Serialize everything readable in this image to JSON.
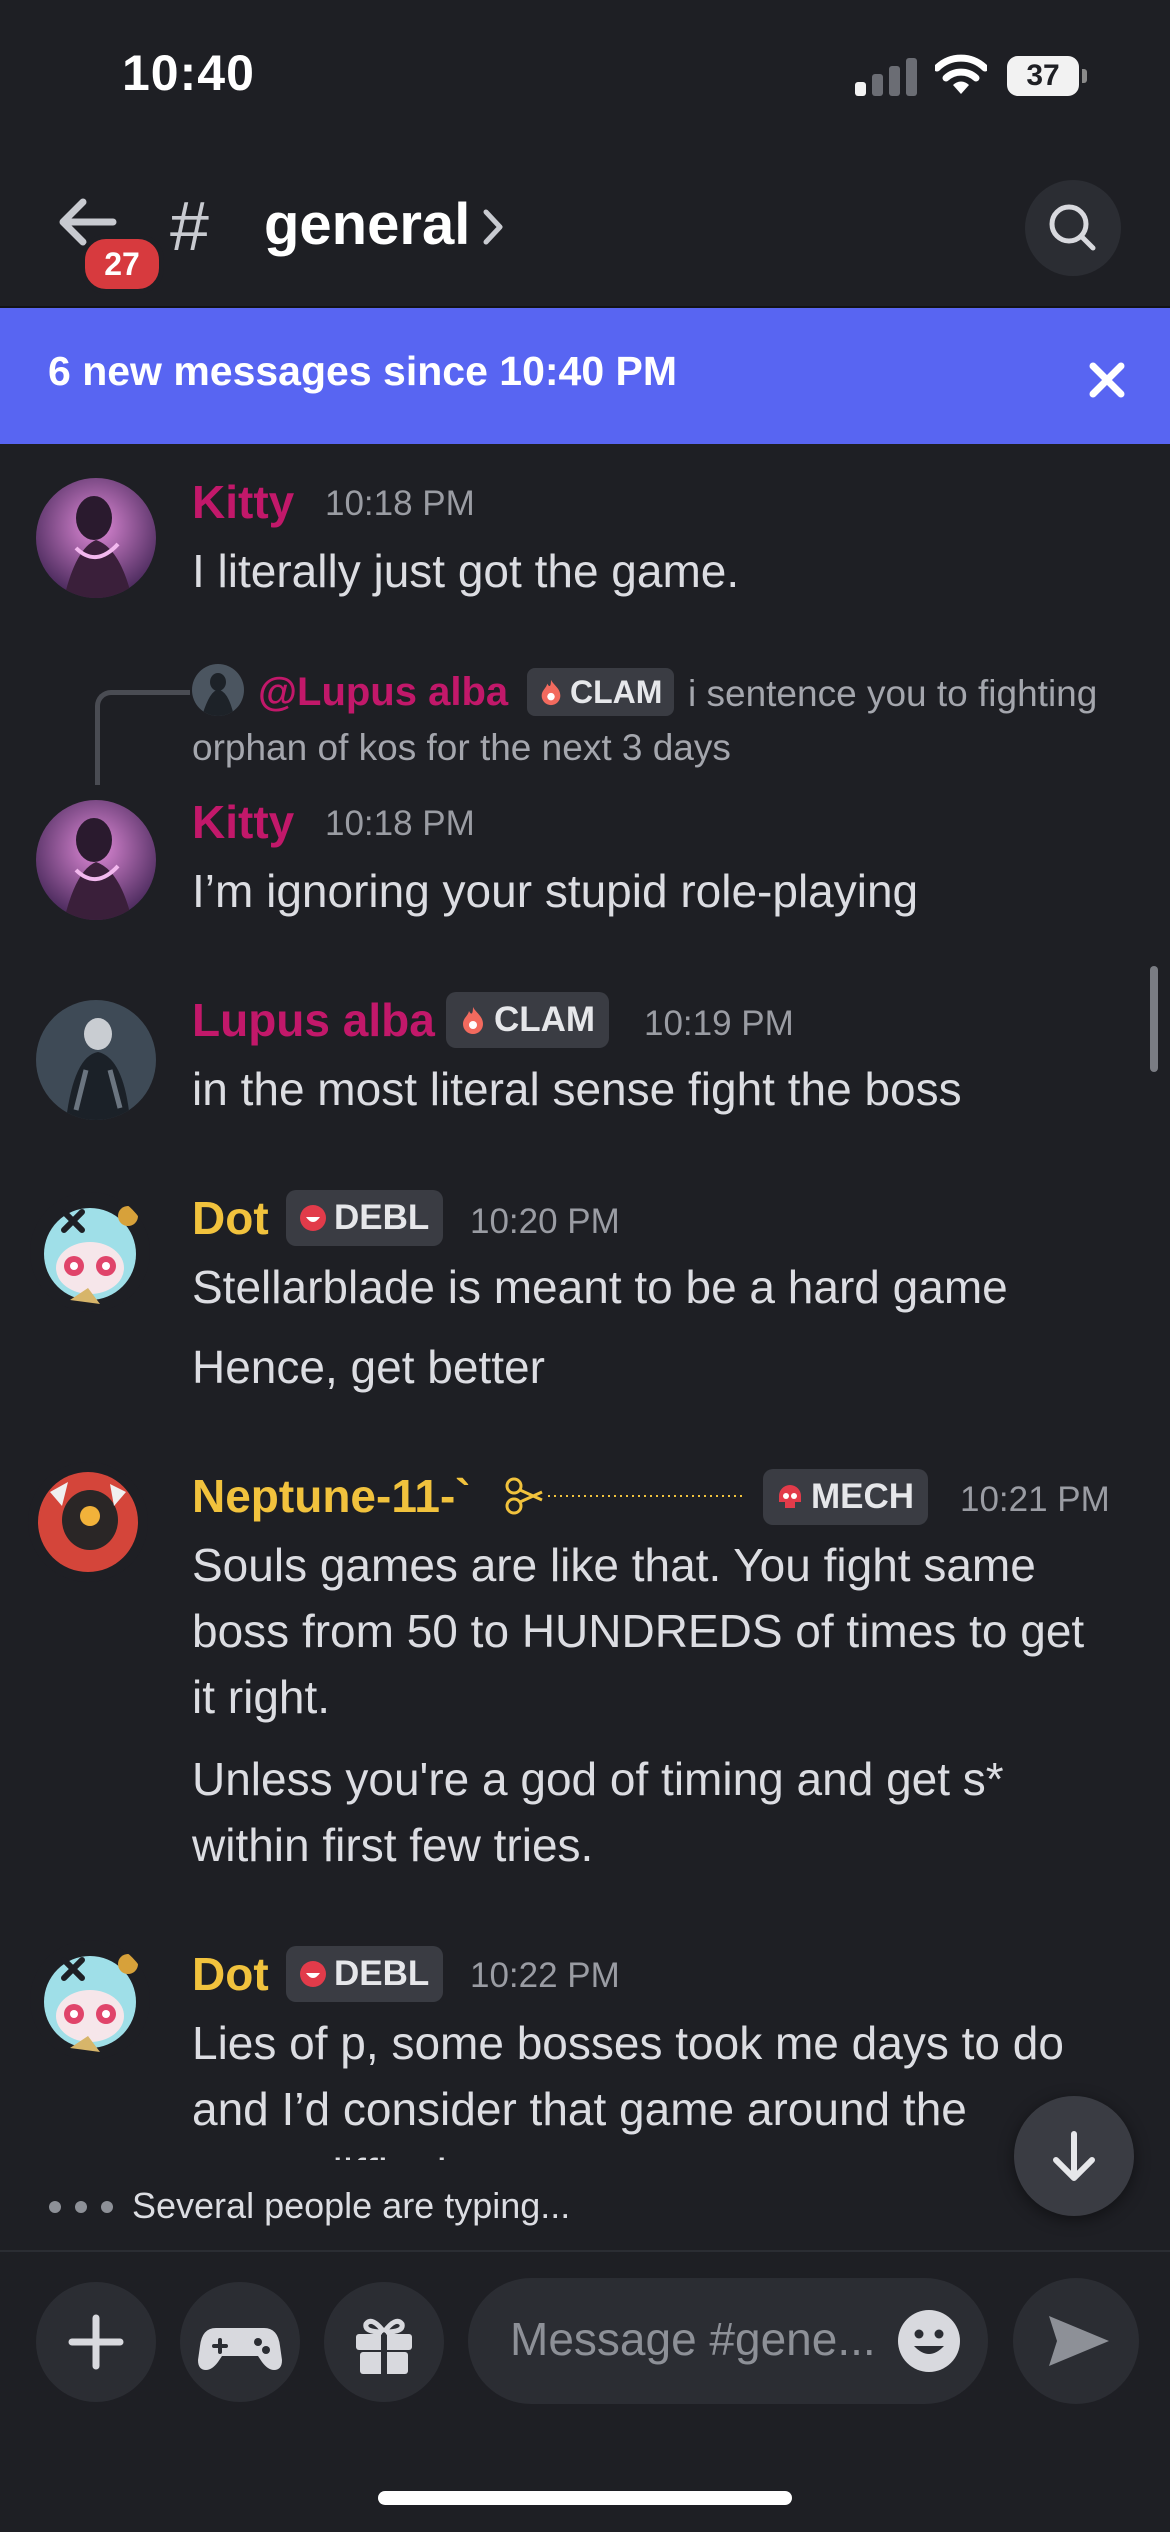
{
  "status_bar": {
    "time": "10:40",
    "battery": "37"
  },
  "header": {
    "badge_count": "27",
    "hash": "#",
    "channel": "general"
  },
  "banner": {
    "text": "6 new messages since 10:40 PM"
  },
  "reply": {
    "mention": "@Lupus alba",
    "tag": "CLAM",
    "text_line1": "i sentence you to fighting",
    "text_line2": "orphan of kos for the next 3 days"
  },
  "messages": [
    {
      "author": "Kitty",
      "time": "10:18 PM",
      "lines": [
        "I literally just got the game."
      ]
    },
    {
      "author": "Kitty",
      "time": "10:18 PM",
      "lines": [
        "I’m ignoring your stupid role-playing"
      ]
    },
    {
      "author": "Lupus alba",
      "tag": "CLAM",
      "time": "10:19 PM",
      "lines": [
        "in the most literal sense fight the boss"
      ]
    },
    {
      "author": "Dot",
      "tag": "DEBL",
      "time": "10:20 PM",
      "lines": [
        "Stellarblade is meant to be a hard game",
        "Hence, get better"
      ]
    },
    {
      "author": "Neptune-11-`",
      "tag": "MECH",
      "time": "10:21 PM",
      "lines": [
        "Souls games are like that. You fight same",
        "boss from 50 to HUNDREDS of times to get",
        "it right.",
        "Unless you're a god of timing and get s*",
        "within first few tries."
      ]
    },
    {
      "author": "Dot",
      "tag": "DEBL",
      "time": "10:22 PM",
      "lines": [
        "Lies of p, some bosses took me days to do",
        "and I’d consider that game around the",
        "same difficulty"
      ]
    }
  ],
  "typing": {
    "text": "Several people are typing..."
  },
  "composer": {
    "placeholder": "Message #gene..."
  },
  "colors": {
    "banner": "#5865f2",
    "kitty": "#c2186a",
    "dot": "#f1c23d",
    "background": "#1e1f24"
  }
}
